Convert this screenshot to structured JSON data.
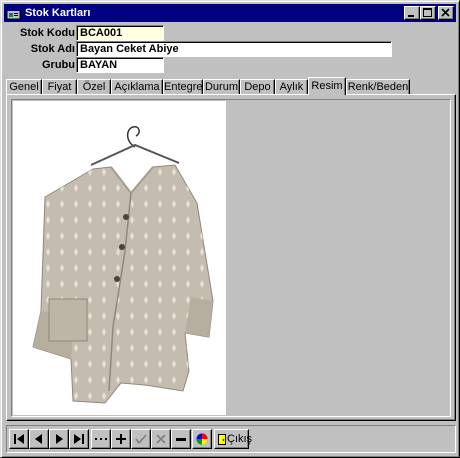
{
  "window": {
    "title": "Stok Kartları"
  },
  "form": {
    "stock_code": {
      "label": "Stok Kodu",
      "value": "BCA001"
    },
    "stock_name": {
      "label": "Stok Adı",
      "value": "Bayan Ceket Abiye"
    },
    "group": {
      "label": "Grubu",
      "value": "BAYAN"
    }
  },
  "tabs": [
    "Genel",
    "Fiyat",
    "Özel",
    "Açıklama",
    "Entegre",
    "Durum",
    "Depo",
    "Aylık",
    "Resim",
    "Renk/Beden"
  ],
  "active_tab": "Resim",
  "navigator": {
    "buttons": [
      "first-icon",
      "prior-icon",
      "next-icon",
      "last-icon",
      "more-icon",
      "insert-icon",
      "post-icon",
      "cancel-icon",
      "delete-icon",
      "color-icon"
    ],
    "exit_label": "Çıkış"
  },
  "colors": {
    "title_bar": "#000080",
    "face": "#c0c0c0",
    "code_field": "#ffffe1"
  }
}
